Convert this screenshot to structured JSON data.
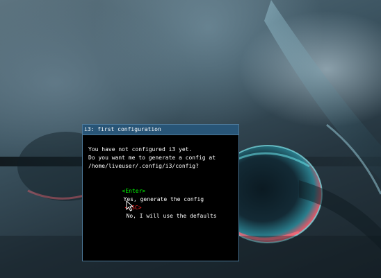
{
  "window": {
    "title": "i3: first configuration"
  },
  "message": {
    "line1": "You have not configured i3 yet.",
    "line2": "Do you want me to generate a config at",
    "line3": "/home/liveuser/.config/i3/config?"
  },
  "options": {
    "enter_key": "<Enter>",
    "enter_label": "Yes, generate the config",
    "esc_key": "<ESC>",
    "esc_label": "No, I will use the defaults"
  },
  "colors": {
    "title_bg": "#285577",
    "border": "#4c7899",
    "enter_key": "#00ff00",
    "esc_key": "#ff2222"
  }
}
